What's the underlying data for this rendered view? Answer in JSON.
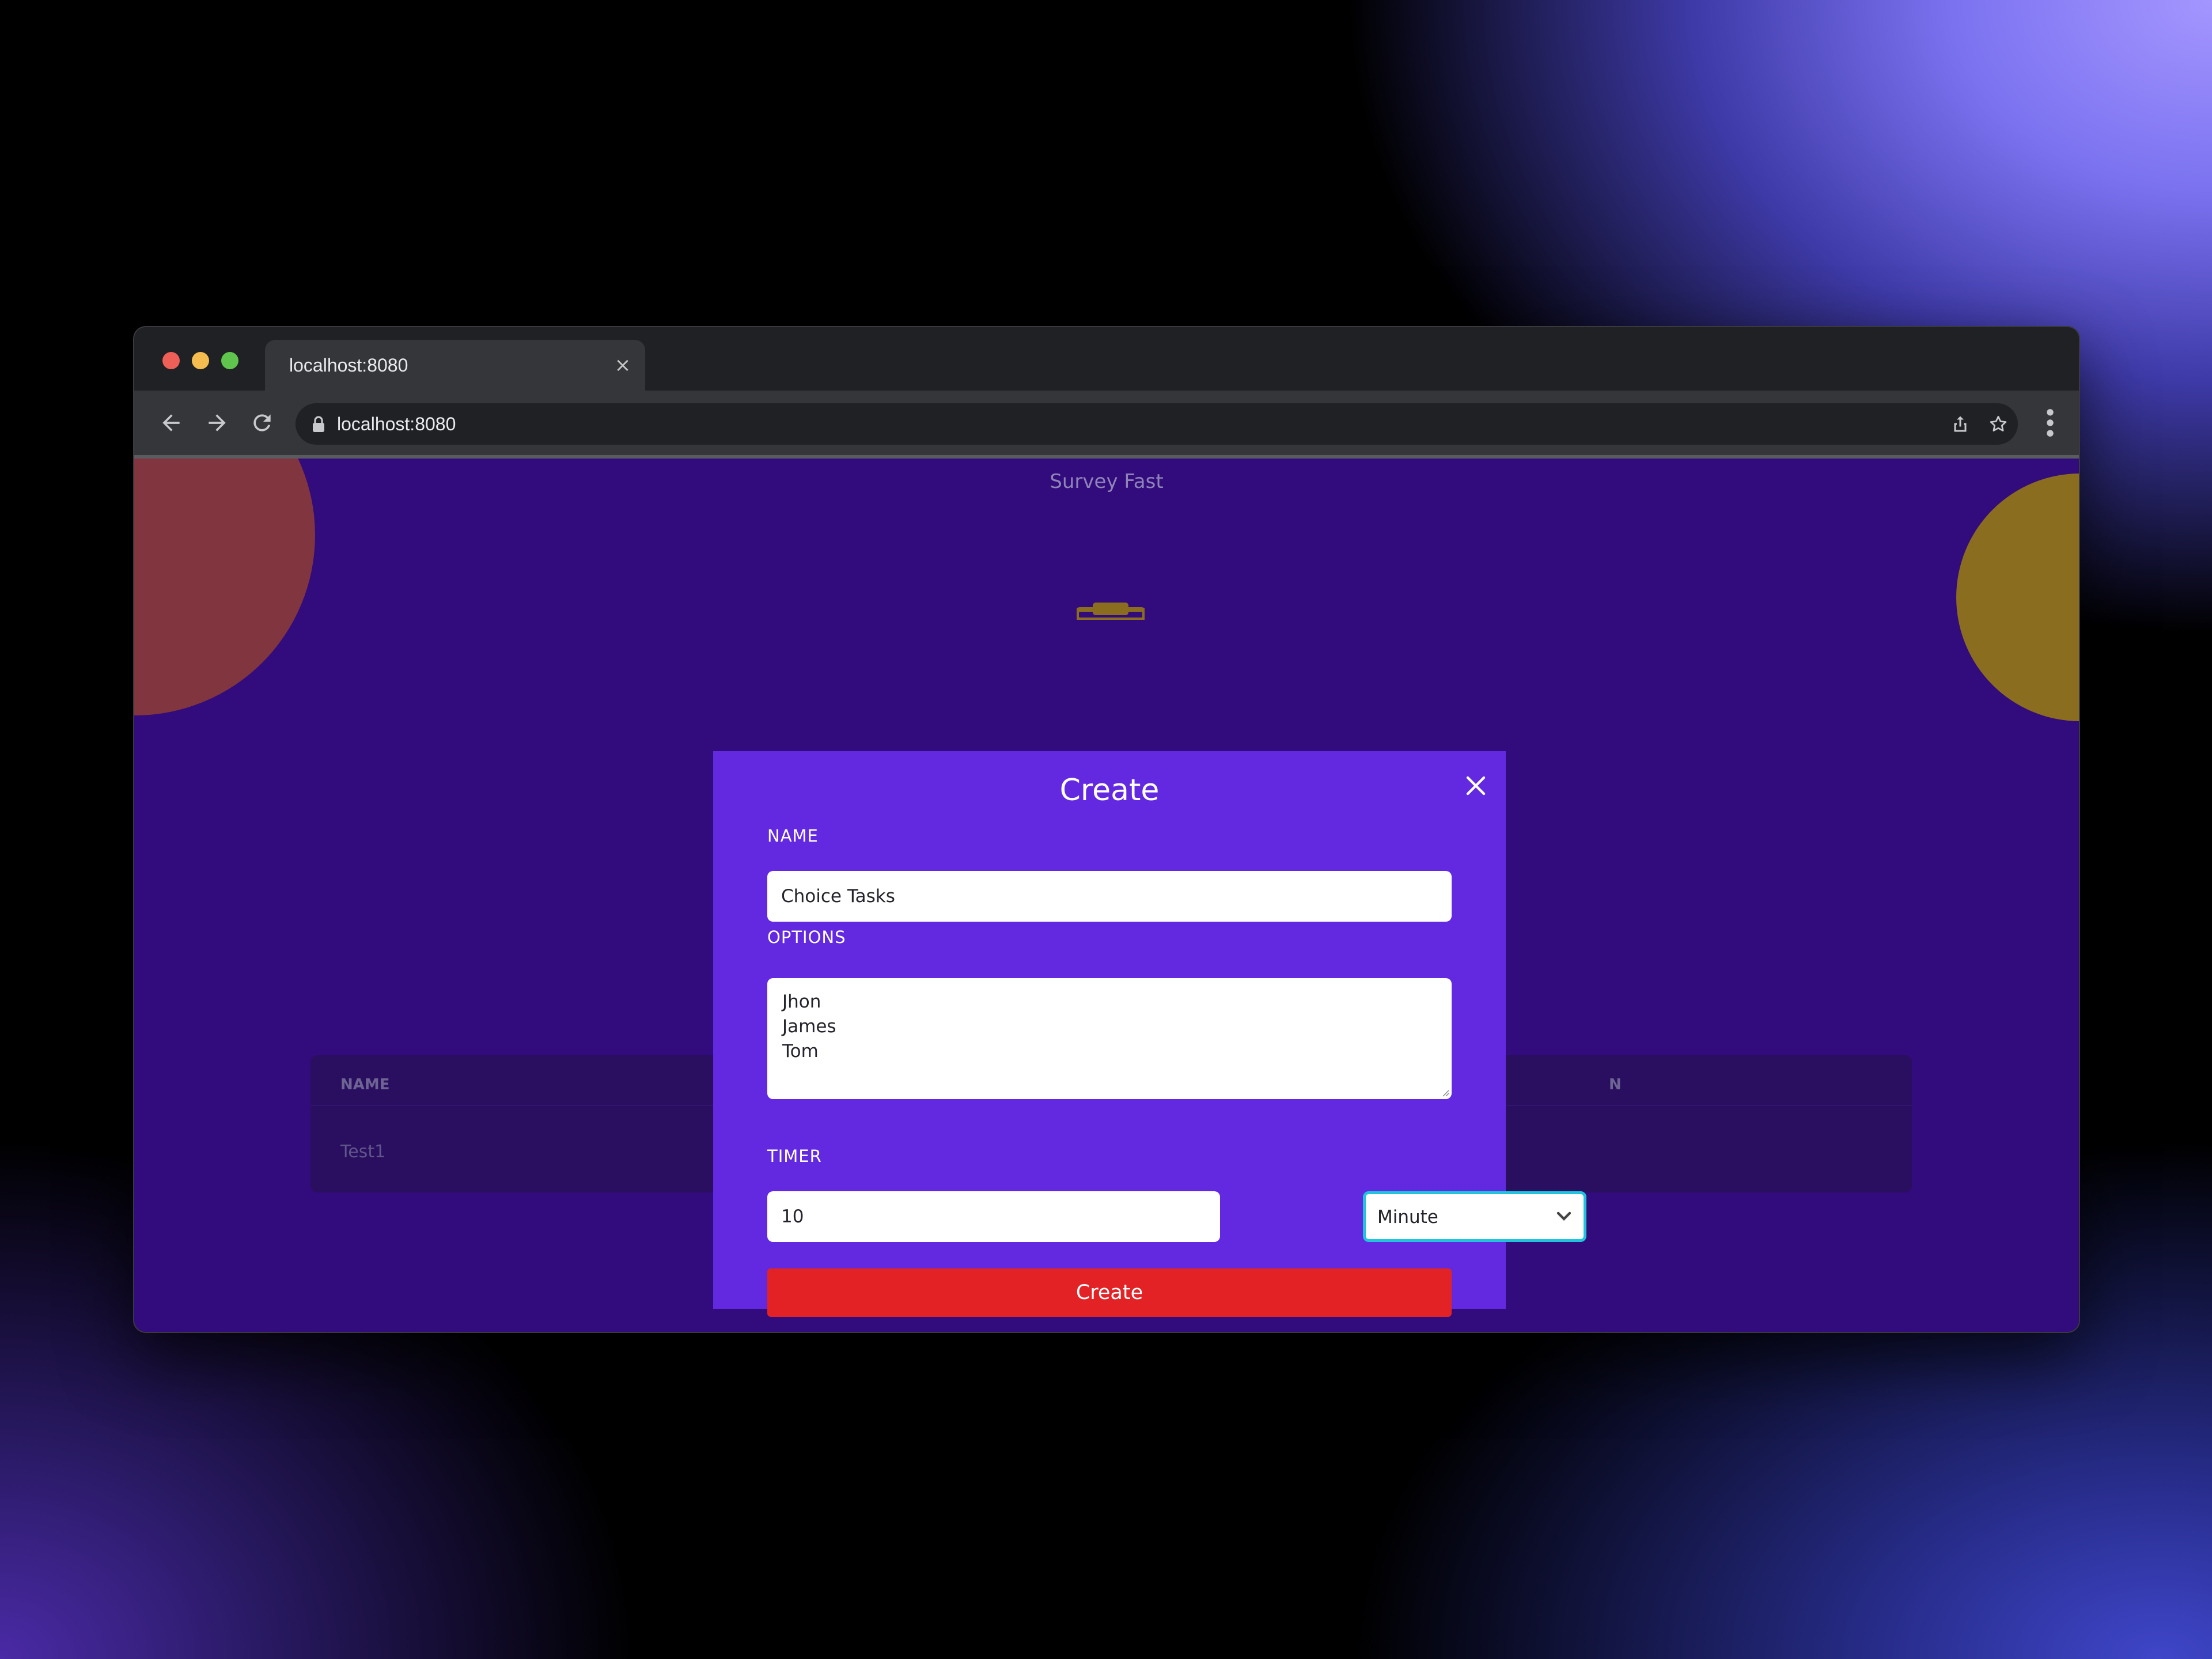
{
  "browser": {
    "tab_title": "localhost:8080",
    "url": "localhost:8080",
    "tab_close_glyph": "×"
  },
  "page": {
    "site_title": "Survey Fast",
    "table": {
      "header_name": "NAME",
      "header_partial": "N",
      "rows": [
        {
          "name": "Test1"
        }
      ]
    }
  },
  "modal": {
    "title": "Create",
    "name_label": "NAME",
    "name_value": "Choice Tasks",
    "options_label": "OPTIONS",
    "options_value": "Jhon\nJames\nTom",
    "timer_label": "TIMER",
    "timer_value": "10",
    "timer_unit": "Minute",
    "submit_label": "Create"
  },
  "colors": {
    "modal_bg": "#6329e0",
    "page_bg": "#320b7c",
    "submit_bg": "#e32226",
    "select_focus": "#20c4dc"
  },
  "icons": [
    "back-arrow-icon",
    "forward-arrow-icon",
    "reload-icon",
    "lock-icon",
    "share-icon",
    "star-icon",
    "menu-dots-icon",
    "close-icon",
    "chevron-down-icon",
    "clipboard-icon"
  ]
}
